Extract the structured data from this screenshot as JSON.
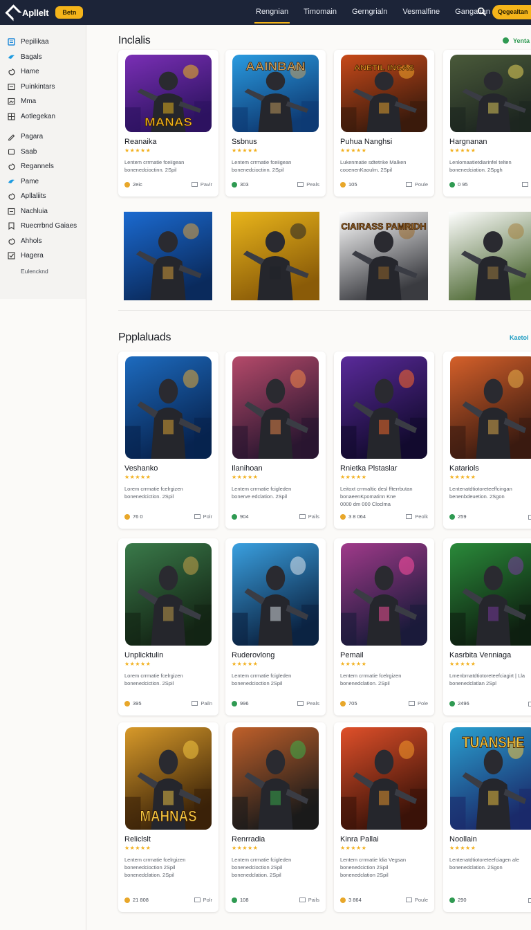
{
  "app": {
    "name": "Apllelt",
    "beta_label": "Betn"
  },
  "nav": {
    "items": [
      {
        "label": "Rengnian",
        "active": true
      },
      {
        "label": "Timomain",
        "active": false
      },
      {
        "label": "Gerngrialn",
        "active": false
      },
      {
        "label": "Vesmalfine",
        "active": false
      },
      {
        "label": "Gangatian",
        "active": false
      }
    ],
    "search_icon": "search-icon",
    "cta_label": "Qegealtan"
  },
  "sidebar": {
    "items": [
      {
        "label": "Pepilikaa",
        "icon": "doc-icon"
      },
      {
        "label": "Bagals",
        "icon": "bird-icon"
      },
      {
        "label": "Hame",
        "icon": "spiral-icon"
      },
      {
        "label": "Puinkintars",
        "icon": "list-icon"
      },
      {
        "label": "Mma",
        "icon": "image-icon"
      },
      {
        "label": "Aotlegekan",
        "icon": "grid-icon"
      },
      {
        "label": "Pagara",
        "icon": "pencil-icon"
      },
      {
        "label": "Saab",
        "icon": "square-icon"
      },
      {
        "label": "Regannels",
        "icon": "spiral-icon"
      },
      {
        "label": "Pame",
        "icon": "bird-icon"
      },
      {
        "label": "Apllaliits",
        "icon": "spiral-icon"
      },
      {
        "label": "Nachluia",
        "icon": "list-icon"
      },
      {
        "label": "Ruecrrbnd Gaiaes",
        "icon": "bookmark-icon"
      },
      {
        "label": "Ahhols",
        "icon": "spiral-icon"
      },
      {
        "label": "Hagera",
        "icon": "check-icon"
      }
    ],
    "footer": "Eulencknd"
  },
  "sections": {
    "featured": {
      "title": "Inclalis",
      "link_label": "Yenta"
    },
    "popular": {
      "title": "Ppplaluads",
      "link_label": "Kaetol"
    }
  },
  "colors": {
    "topbar": "#1c2438",
    "accent": "#f4b41a",
    "star": "#f2b01e",
    "link_green": "#2f9a52",
    "link_teal": "#1b9bc2"
  },
  "featured_cards": [
    {
      "title": "Reanaika",
      "stars": "★★★★★",
      "desc": "Lentem crrmatie fceiigean\nbonenedcioctinn. 2Spil",
      "meta": "2eic",
      "action": "Pavir",
      "badge": "MANAS",
      "palette": [
        "#7a2fb5",
        "#2d1360",
        "#f0b91c"
      ]
    },
    {
      "title": "Ssbnus",
      "stars": "★★★★★",
      "desc": "Lentem crrmatie fceiigean\nbonenedcioctinn. 2Spil",
      "meta": "303",
      "action": "Peals",
      "badge": "AAINBAN",
      "palette": [
        "#2a9be0",
        "#0e3b74",
        "#c8a060"
      ]
    },
    {
      "title": "Puhua Nanghsi",
      "stars": "★★★★★",
      "desc": "Lukenmatie sdtetnke Malken\ncooenenKaoulm. 2Spil",
      "meta": "105",
      "action": "Poule",
      "badge": "ANETIL INCAS",
      "palette": [
        "#c84a1a",
        "#3a1a0c",
        "#f3a52a"
      ]
    },
    {
      "title": "Hargnanan",
      "stars": "★★★★★",
      "desc": "Lenlomaatietdiarinfel telten\nbonenedciation. 2Spgh",
      "meta": "0 95",
      "action": "Ba",
      "badge": "",
      "palette": [
        "#4a5a3a",
        "#1d2620",
        "#e6d25a"
      ]
    }
  ],
  "featured_tiles": [
    {
      "palette": [
        "#1b6ad0",
        "#0a2a5c",
        "#e0a33a"
      ]
    },
    {
      "palette": [
        "#e9b51b",
        "#8a5b08",
        "#1f2128"
      ]
    },
    {
      "palette": [
        "#ffffff",
        "#3a3b40",
        "#9b6a2a"
      ],
      "badge": "CIAIRASS PAMRIDH"
    },
    {
      "palette": [
        "#ffffff",
        "#4f6a35",
        "#a58140"
      ]
    }
  ],
  "popular_cards": [
    {
      "title": "Veshanko",
      "stars": "★★★★★",
      "desc": "Lorem crrmatie fcelrgizen\nbonenedciction. 2Spil",
      "meta": "76 0",
      "action": "Polr",
      "palette": [
        "#1d6bbf",
        "#07234f",
        "#e5a934"
      ]
    },
    {
      "title": "Ilanihoan",
      "stars": "★★★★★",
      "desc": "Lentem crrmatie fcigleden\nbonerve edclation. 2Spil",
      "meta": "904",
      "action": "Pails",
      "palette": [
        "#b54a6a",
        "#2a1630",
        "#f2884a"
      ]
    },
    {
      "title": "Rnietka Plstaslar",
      "stars": "★★★★★",
      "desc": "Leitoxt crrmaltic desl ffterrbutan\nbonaeenKpomatinn Kne\n0000 dm 000 Cloclma",
      "meta": "3 8 064",
      "action": "Peolk",
      "palette": [
        "#5a2a9a",
        "#120a2e",
        "#ff6a2a"
      ]
    },
    {
      "title": "Katariols",
      "stars": "★★★★★",
      "desc": "Lentenatdtiotoreteeffcingan\nbenenbdeuetion. 2Sgon",
      "meta": "259",
      "action": "",
      "palette": [
        "#d5602a",
        "#3a1a10",
        "#e8b04a"
      ]
    },
    {
      "title": "Unplicktulin",
      "stars": "★★★★★",
      "desc": "Lorem crrmatie fcelrgizen\nbonenedciction. 2Spil",
      "meta": "395",
      "action": "Pailn",
      "palette": [
        "#3a7a4a",
        "#132414",
        "#c9a34a"
      ]
    },
    {
      "title": "Ruderovlong",
      "stars": "★★★★★",
      "desc": "Lentem crrmatie fcigleden\nbonenedcioction 2Spil",
      "meta": "996",
      "action": "Peals",
      "palette": [
        "#3aa0e0",
        "#0b2342",
        "#dfe8f0"
      ]
    },
    {
      "title": "Pemail",
      "stars": "★★★★★",
      "desc": "Lentem crrmatie fcelrgizen\nbonenedclation. 2Spil",
      "meta": "705",
      "action": "Pole",
      "palette": [
        "#a03a8a",
        "#1a1a3a",
        "#ff4fa0"
      ]
    },
    {
      "title": "Kasrbita Venniaga",
      "stars": "★★★★★",
      "desc": "Lmenbmatdtiotoreteefciagirt | Lla\nbonenedclatlan 2Spl",
      "meta": "2496",
      "action": "",
      "palette": [
        "#2a8a3a",
        "#0e1f10",
        "#7a3aa0"
      ]
    },
    {
      "title": "Reliclslt",
      "stars": "★★★★★",
      "desc": "Lentem crrmatie fcelrgizen\nbonenedcioction 2Spil\nbonenedclation. 2Spil",
      "meta": "21 808",
      "action": "Polr",
      "badge": "MAHNAS",
      "palette": [
        "#d89a2a",
        "#3a2208",
        "#f5c842"
      ]
    },
    {
      "title": "Renrradia",
      "stars": "★★★★★",
      "desc": "Lentem crrmatie fcigleden\nbonenedcioction 2Spil\nbonenedclation. 2Spil",
      "meta": "108",
      "action": "Pails",
      "palette": [
        "#c0602a",
        "#1a1a1a",
        "#3ab04a"
      ]
    },
    {
      "title": "Kinra Pallai",
      "stars": "★★★★★",
      "desc": "Lentem crrmatie ldia Vegsan\nbonenedciction 2Spil\nbonenedclation 2Spil",
      "meta": "3 864",
      "action": "Poule",
      "palette": [
        "#e0502a",
        "#3a1208",
        "#f59a2a"
      ]
    },
    {
      "title": "Noollain",
      "stars": "★★★★★",
      "desc": "Lentenatdtiotoreteefciagen ale\nbonenedclation. 2Sgon",
      "meta": "290",
      "action": "",
      "badge": "TUANSHE",
      "palette": [
        "#2aa0d0",
        "#1a2a6a",
        "#f5c842"
      ]
    }
  ]
}
